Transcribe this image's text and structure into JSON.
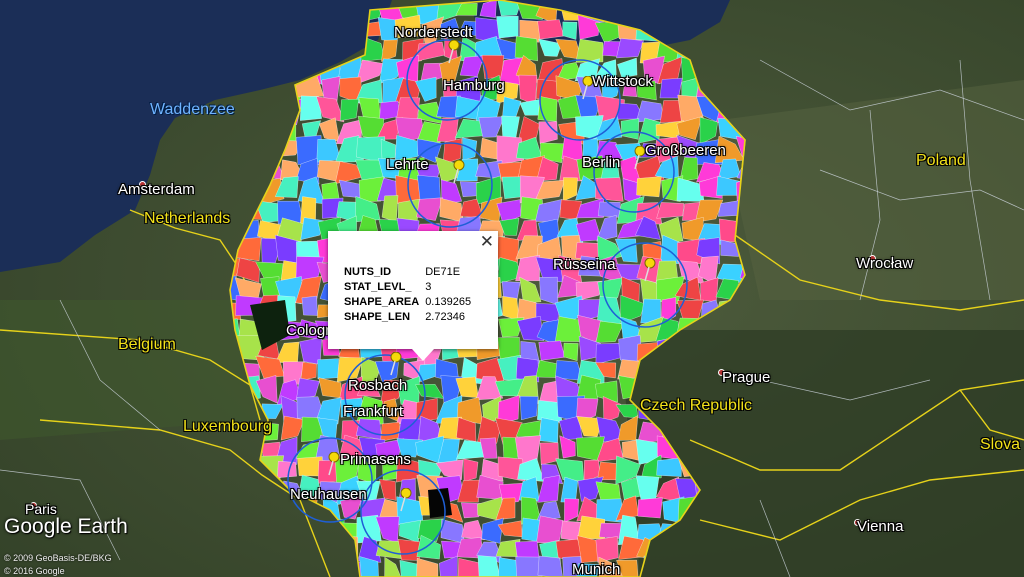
{
  "map": {
    "cities": {
      "norderstedt": "Norderstedt",
      "hamburg": "Hamburg",
      "wittstock": "Wittstock",
      "lehrte": "Lehrte",
      "berlin": "Berlin",
      "grossbeeren": "Großbeeren",
      "amsterdam": "Amsterdam",
      "russeina": "Rüsseina",
      "wroclaw": "Wrocław",
      "cologne": "Cologne",
      "rosbach": "Rosbach",
      "frankfurt": "Frankfurt",
      "prague": "Prague",
      "primasens": "Primasens",
      "neuhausen": "Neuhausen",
      "paris": "Paris",
      "vienna": "Vienna",
      "munich": "Munich"
    },
    "countries": {
      "poland": "Poland",
      "netherlands": "Netherlands",
      "belgium": "Belgium",
      "czech_republic": "Czech Republic",
      "luxembourg": "Luxembourg",
      "slovakia_partial": "Slova"
    },
    "water": {
      "waddenzee": "Waddenzee"
    }
  },
  "popup": {
    "close_glyph": "✕",
    "rows": [
      {
        "key": "NUTS_ID",
        "value": "DE71E"
      },
      {
        "key": "STAT_LEVL_",
        "value": "3"
      },
      {
        "key": "SHAPE_AREA",
        "value": "0.139265"
      },
      {
        "key": "SHAPE_LEN",
        "value": "2.72346"
      }
    ]
  },
  "branding": {
    "logo": "Google Earth",
    "copyright_1": "© 2009 GeoBasis-DE/BKG",
    "copyright_2": "© 2016 Google"
  },
  "icons": {
    "placemark": "yellow-pushpin-icon",
    "close": "close-icon"
  },
  "colors": {
    "placemark": "#f5d90a",
    "ring": "#1f5fd6",
    "border": "#e6d21a",
    "popup_bg": "#ffffff"
  }
}
